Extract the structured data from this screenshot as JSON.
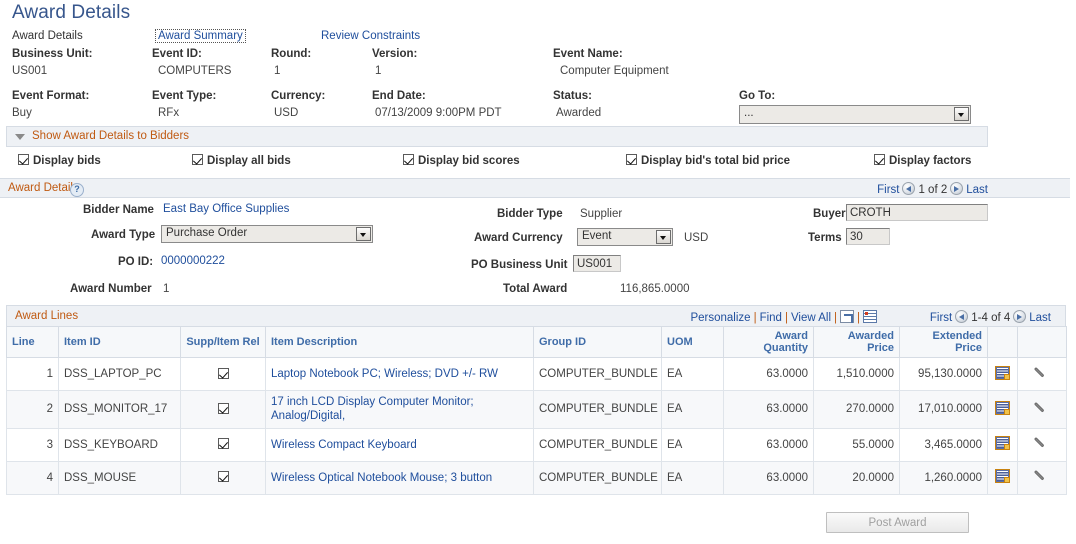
{
  "page": {
    "title": "Award Details"
  },
  "subnav": {
    "current": "Award Details",
    "award_summary": "Award Summary",
    "review_constraints": "Review Constraints"
  },
  "header": {
    "business_unit_label": "Business Unit:",
    "business_unit_value": "US001",
    "event_id_label": "Event ID:",
    "event_id_value": "COMPUTERS",
    "round_label": "Round:",
    "round_value": "1",
    "version_label": "Version:",
    "version_value": "1",
    "event_name_label": "Event Name:",
    "event_name_value": "Computer Equipment",
    "event_format_label": "Event Format:",
    "event_format_value": "Buy",
    "event_type_label": "Event Type:",
    "event_type_value": "RFx",
    "currency_label": "Currency:",
    "currency_value": "USD",
    "end_date_label": "End Date:",
    "end_date_value": "07/13/2009  9:00PM PDT",
    "status_label": "Status:",
    "status_value": "Awarded",
    "goto_label": "Go To:",
    "goto_value": "..."
  },
  "show_bidders": {
    "label": "Show Award Details to Bidders",
    "expand_icon": "triangle-down-icon"
  },
  "checkboxes": [
    {
      "label": "Display bids",
      "checked": true
    },
    {
      "label": "Display all bids",
      "checked": true
    },
    {
      "label": "Display bid scores",
      "checked": true
    },
    {
      "label": "Display bid's total bid price",
      "checked": true
    },
    {
      "label": "Display factors",
      "checked": true
    }
  ],
  "award_details_section": {
    "title": "Award Details",
    "help_icon": "question-mark-icon",
    "paging": {
      "first": "First",
      "position": "1 of 2",
      "last": "Last",
      "prev_icon": "arrow-left-icon",
      "next_icon": "arrow-right-icon"
    },
    "bidder_name_label": "Bidder Name",
    "bidder_name_value": "East Bay Office Supplies",
    "award_type_label": "Award Type",
    "award_type_value": "Purchase Order",
    "po_id_label": "PO ID:",
    "po_id_value": "0000000222",
    "award_number_label": "Award Number",
    "award_number_value": "1",
    "bidder_type_label": "Bidder Type",
    "bidder_type_value": "Supplier",
    "award_currency_label": "Award Currency",
    "award_currency_value": "Event",
    "award_currency_suffix": "USD",
    "po_business_unit_label": "PO Business Unit",
    "po_business_unit_value": "US001",
    "total_award_label": "Total Award",
    "total_award_value": "116,865.0000",
    "buyer_label": "Buyer",
    "buyer_value": "CROTH",
    "terms_label": "Terms",
    "terms_value": "30"
  },
  "award_lines": {
    "title": "Award Lines",
    "tools": {
      "personalize": "Personalize",
      "find": "Find",
      "view_all": "View All",
      "popup_icon": "popup-window-icon",
      "grid_icon": "download-spreadsheet-icon"
    },
    "paging": {
      "first": "First",
      "position": "1-4 of 4",
      "last": "Last",
      "prev_icon": "arrow-left-icon",
      "next_icon": "arrow-right-icon"
    },
    "columns": [
      "Line",
      "Item ID",
      "Supp/Item Rel",
      "Item Description",
      "Group ID",
      "UOM",
      "Award Quantity",
      "Awarded Price",
      "Extended Price",
      "",
      ""
    ],
    "rows": [
      {
        "line": "1",
        "item_id": "DSS_LAPTOP_PC",
        "supp_item_rel": true,
        "description": "Laptop Notebook PC; Wireless; DVD +/- RW",
        "group_id": "COMPUTER_BUNDLE",
        "uom": "EA",
        "award_quantity": "63.0000",
        "awarded_price": "1,510.0000",
        "extended_price": "95,130.0000",
        "sheet_icon": "spreadsheet-icon",
        "attach_icon": "paperclip-icon"
      },
      {
        "line": "2",
        "item_id": "DSS_MONITOR_17",
        "supp_item_rel": true,
        "description": "17 inch LCD Display Computer Monitor; Analog/Digital,",
        "group_id": "COMPUTER_BUNDLE",
        "uom": "EA",
        "award_quantity": "63.0000",
        "awarded_price": "270.0000",
        "extended_price": "17,010.0000",
        "sheet_icon": "spreadsheet-icon",
        "attach_icon": "paperclip-icon"
      },
      {
        "line": "3",
        "item_id": "DSS_KEYBOARD",
        "supp_item_rel": true,
        "description": "Wireless Compact Keyboard",
        "group_id": "COMPUTER_BUNDLE",
        "uom": "EA",
        "award_quantity": "63.0000",
        "awarded_price": "55.0000",
        "extended_price": "3,465.0000",
        "sheet_icon": "spreadsheet-icon",
        "attach_icon": "paperclip-icon"
      },
      {
        "line": "4",
        "item_id": "DSS_MOUSE",
        "supp_item_rel": true,
        "description": "Wireless Optical Notebook Mouse; 3 button",
        "group_id": "COMPUTER_BUNDLE",
        "uom": "EA",
        "award_quantity": "63.0000",
        "awarded_price": "20.0000",
        "extended_price": "1,260.0000",
        "sheet_icon": "spreadsheet-icon",
        "attach_icon": "paperclip-icon"
      }
    ]
  },
  "footer": {
    "post_award_label": "Post Award",
    "post_award_disabled": true
  },
  "colors": {
    "title_blue": "#37568c",
    "link_blue": "#1f4e9c",
    "section_orange": "#c05a12",
    "header_band": "#eef1f5",
    "grid_header_text": "#3f6ca8"
  }
}
